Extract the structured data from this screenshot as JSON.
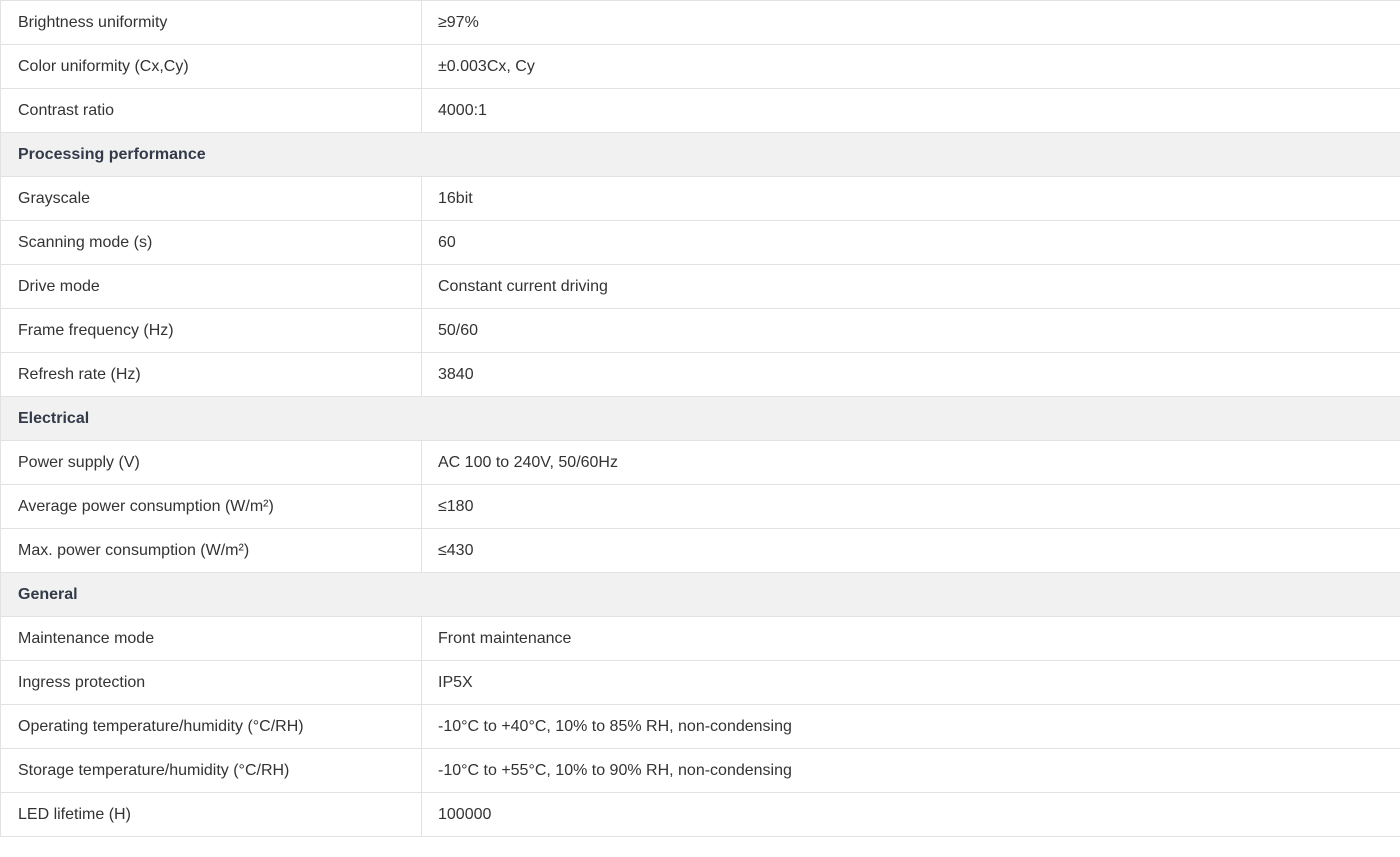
{
  "rows": [
    {
      "kind": "item",
      "label": "Brightness uniformity",
      "value": "≥97%"
    },
    {
      "kind": "item",
      "label": "Color uniformity (Cx,Cy)",
      "value": "±0.003Cx, Cy"
    },
    {
      "kind": "item",
      "label": "Contrast ratio",
      "value": "4000:1"
    },
    {
      "kind": "section",
      "label": "Processing performance"
    },
    {
      "kind": "item",
      "label": "Grayscale",
      "value": "16bit"
    },
    {
      "kind": "item",
      "label": "Scanning mode (s)",
      "value": "60"
    },
    {
      "kind": "item",
      "label": "Drive mode",
      "value": "Constant current driving"
    },
    {
      "kind": "item",
      "label": "Frame frequency (Hz)",
      "value": "50/60"
    },
    {
      "kind": "item",
      "label": "Refresh rate (Hz)",
      "value": "3840"
    },
    {
      "kind": "section",
      "label": "Electrical"
    },
    {
      "kind": "item",
      "label": "Power supply (V)",
      "value": "AC 100 to 240V, 50/60Hz"
    },
    {
      "kind": "item",
      "label": "Average power consumption (W/m²)",
      "value": "≤180"
    },
    {
      "kind": "item",
      "label": "Max. power consumption (W/m²)",
      "value": "≤430"
    },
    {
      "kind": "section",
      "label": "General"
    },
    {
      "kind": "item",
      "label": "Maintenance mode",
      "value": "Front maintenance"
    },
    {
      "kind": "item",
      "label": "Ingress protection",
      "value": "IP5X"
    },
    {
      "kind": "item",
      "label": "Operating temperature/humidity (°C/RH)",
      "value": "-10°C to +40°C, 10% to 85% RH, non-condensing"
    },
    {
      "kind": "item",
      "label": "Storage temperature/humidity (°C/RH)",
      "value": "-10°C to +55°C, 10% to 90% RH, non-condensing"
    },
    {
      "kind": "item",
      "label": "LED lifetime (H)",
      "value": "100000"
    }
  ]
}
